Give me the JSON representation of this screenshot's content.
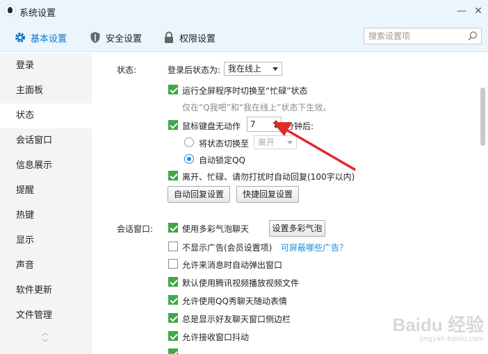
{
  "window": {
    "title": "系统设置",
    "minimize_glyph": "—",
    "close_glyph": "✕"
  },
  "tabs": [
    {
      "label": "基本设置",
      "icon": "gear-icon",
      "active": true
    },
    {
      "label": "安全设置",
      "icon": "shield-icon",
      "active": false
    },
    {
      "label": "权限设置",
      "icon": "lock-icon",
      "active": false
    }
  ],
  "search": {
    "placeholder": "搜索设置项"
  },
  "sidebar": {
    "items": [
      {
        "label": "登录"
      },
      {
        "label": "主面板"
      },
      {
        "label": "状态"
      },
      {
        "label": "会话窗口"
      },
      {
        "label": "信息展示"
      },
      {
        "label": "提醒"
      },
      {
        "label": "热键"
      },
      {
        "label": "显示"
      },
      {
        "label": "声音"
      },
      {
        "label": "软件更新"
      },
      {
        "label": "文件管理"
      }
    ],
    "active_index": 2,
    "scroll_up_glyph": "︿",
    "scroll_down_glyph": "﹀"
  },
  "status_section": {
    "heading": "状态:",
    "login_status_label": "登录后状态为:",
    "login_status_value": "我在线上",
    "fullscreen_busy": {
      "label": "运行全屏程序时切换至“忙碌”状态",
      "checked": true
    },
    "fullscreen_hint": "仅在“Q我吧”和“我在线上”状态下生效。",
    "idle": {
      "label": "鼠标键盘无动作",
      "checked": true,
      "minutes": "7",
      "unit": "分钟后:"
    },
    "switch_status": {
      "label": "将状态切换至",
      "selected": false,
      "value": "离开"
    },
    "auto_lock": {
      "label": "自动锁定QQ",
      "selected": true
    },
    "auto_reply": {
      "label": "离开、忙碌、请勿打扰时自动回复(100字以内)",
      "checked": true
    },
    "auto_reply_button": "自动回复设置",
    "quick_reply_button": "快捷回复设置"
  },
  "chat_section": {
    "heading": "会话窗口:",
    "colorful_bubble": {
      "label": "使用多彩气泡聊天",
      "checked": true
    },
    "bubble_button": "设置多彩气泡",
    "options": [
      {
        "label": "不显示广告(会员设置项)",
        "checked": false
      },
      {
        "label": "允许来消息时自动弹出窗口",
        "checked": false
      },
      {
        "label": "默认使用腾讯视频播放视频文件",
        "checked": true
      },
      {
        "label": "允许使用QQ秀聊天随动表情",
        "checked": true
      },
      {
        "label": "总是显示好友聊天窗口侧边栏",
        "checked": true
      },
      {
        "label": "允许接收窗口抖动",
        "checked": true
      }
    ],
    "ad_link": "可屏蔽哪些广告？"
  },
  "watermark": {
    "text": "Baidu 经验",
    "sub": "jingyan.baidu.com"
  },
  "colors": {
    "accent": "#1173c9",
    "check_green": "#3fa847",
    "link_blue": "#1a8ad8",
    "annotation_red": "#e02a2a"
  }
}
